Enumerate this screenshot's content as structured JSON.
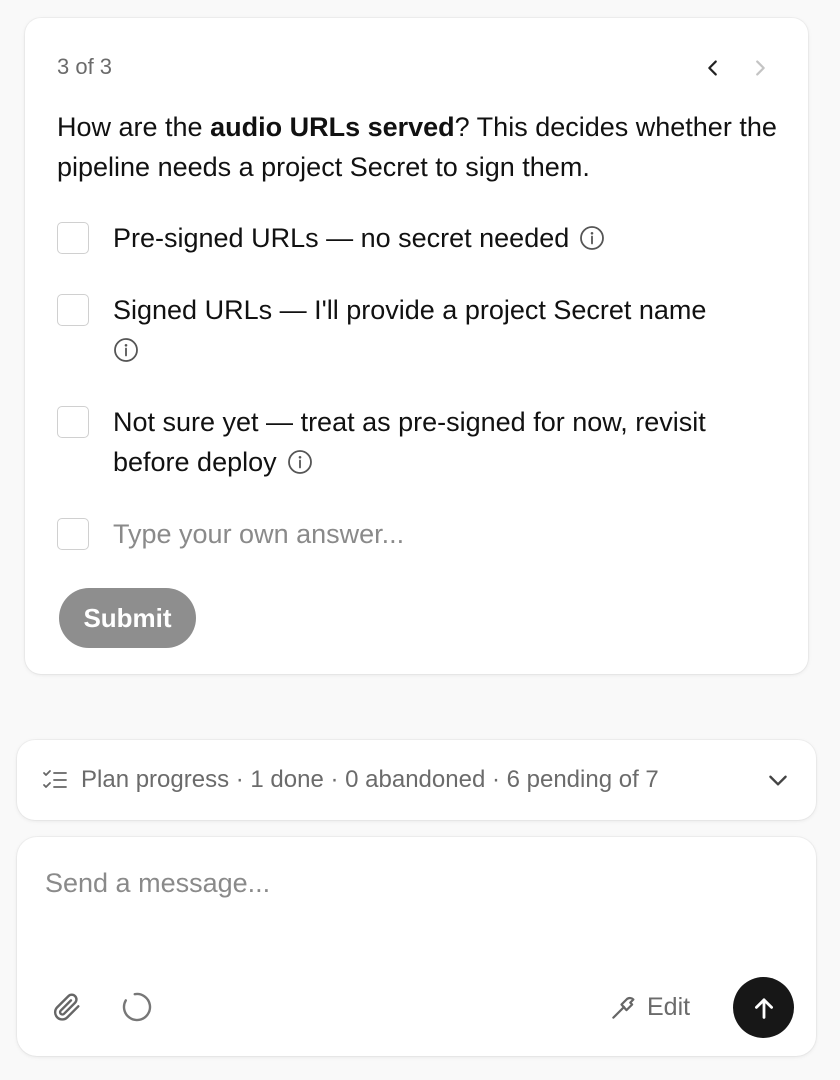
{
  "question_card": {
    "pager": "3 of 3",
    "question": {
      "prefix": "How are the ",
      "emphasis": "audio URLs served",
      "suffix": "? This decides whether the pipeline needs a project Secret to sign them."
    },
    "options": [
      {
        "label": "Pre-signed URLs — no secret needed",
        "checked": false,
        "icon": "info-icon"
      },
      {
        "label": "Signed URLs — I'll provide a project Secret name",
        "checked": false,
        "icon": "info-icon"
      },
      {
        "label": "Not sure yet — treat as pre-signed for now, revisit before deploy",
        "checked": false,
        "icon": "info-icon"
      }
    ],
    "own_answer_placeholder": "Type your own answer...",
    "submit_label": "Submit"
  },
  "plan_progress": {
    "text": "Plan progress · 1 done · 0 abandoned · 6 pending of 7",
    "icon": "checklist-icon",
    "toggle_icon": "chevron-down-icon"
  },
  "composer": {
    "placeholder": "Send a message...",
    "attach_icon": "paperclip-icon",
    "status_icon": "spinner-icon",
    "edit_label": "Edit",
    "edit_icon": "hammer-icon",
    "send_icon": "arrow-up-icon"
  },
  "colors": {
    "background": "#f9f9f9",
    "card": "#ffffff",
    "text": "#111111",
    "muted": "#6b6b6b",
    "submit_disabled": "#8e8e8e",
    "send_button": "#171717"
  }
}
